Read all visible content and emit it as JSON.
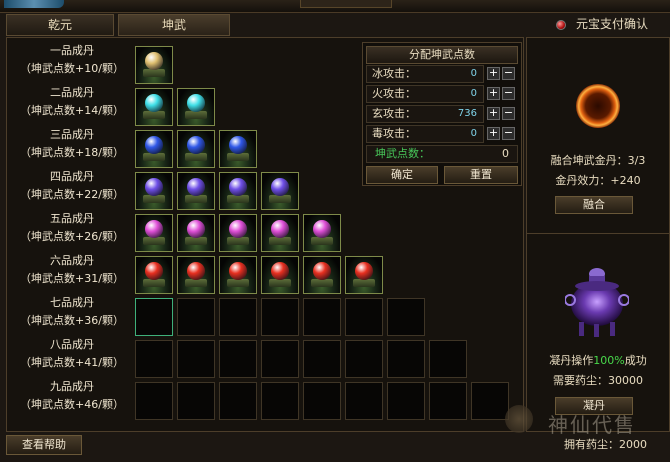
{
  "tabs": [
    "乾元",
    "坤武"
  ],
  "pay_confirm": "元宝支付确认",
  "rows": [
    {
      "name": "一品成丹",
      "points": "（坤武点数+10/颗）",
      "count": 1,
      "filled": 1,
      "color": "#e0c070"
    },
    {
      "name": "二品成丹",
      "points": "（坤武点数+14/颗）",
      "count": 2,
      "filled": 2,
      "color": "#40e0e8"
    },
    {
      "name": "三品成丹",
      "points": "（坤武点数+18/颗）",
      "count": 3,
      "filled": 3,
      "color": "#3058e8"
    },
    {
      "name": "四品成丹",
      "points": "（坤武点数+22/颗）",
      "count": 4,
      "filled": 4,
      "color": "#7050e8"
    },
    {
      "name": "五品成丹",
      "points": "（坤武点数+26/颗）",
      "count": 5,
      "filled": 5,
      "color": "#e050d8"
    },
    {
      "name": "六品成丹",
      "points": "（坤武点数+31/颗）",
      "count": 6,
      "filled": 6,
      "color": "#e83020"
    },
    {
      "name": "七品成丹",
      "points": "（坤武点数+36/颗）",
      "count": 7,
      "filled": 0,
      "color": ""
    },
    {
      "name": "八品成丹",
      "points": "（坤武点数+41/颗）",
      "count": 8,
      "filled": 0,
      "color": ""
    },
    {
      "name": "九品成丹",
      "points": "（坤武点数+46/颗）",
      "count": 9,
      "filled": 0,
      "color": ""
    }
  ],
  "alloc": {
    "title": "分配坤武点数",
    "attrs": [
      {
        "label": "冰攻击：",
        "value": "0"
      },
      {
        "label": "火攻击：",
        "value": "0"
      },
      {
        "label": "玄攻击：",
        "value": "736"
      },
      {
        "label": "毒攻击：",
        "value": "0"
      }
    ],
    "plus": "+",
    "minus": "−",
    "sum_label": "坤武点数：",
    "sum_value": "0",
    "confirm": "确定",
    "reset": "重置"
  },
  "fuse": {
    "count_text": "融合坤武金丹：3/3",
    "effect_text": "金丹效力：+240",
    "button": "融合"
  },
  "condense": {
    "op_prefix": "凝丹操作",
    "op_rate": "100%",
    "op_suffix": "成功",
    "cost_text": "需要药尘：30000",
    "button": "凝丹"
  },
  "help_button": "查看帮助",
  "owned_text": "拥有药尘：2000",
  "watermark": "神仙代售"
}
